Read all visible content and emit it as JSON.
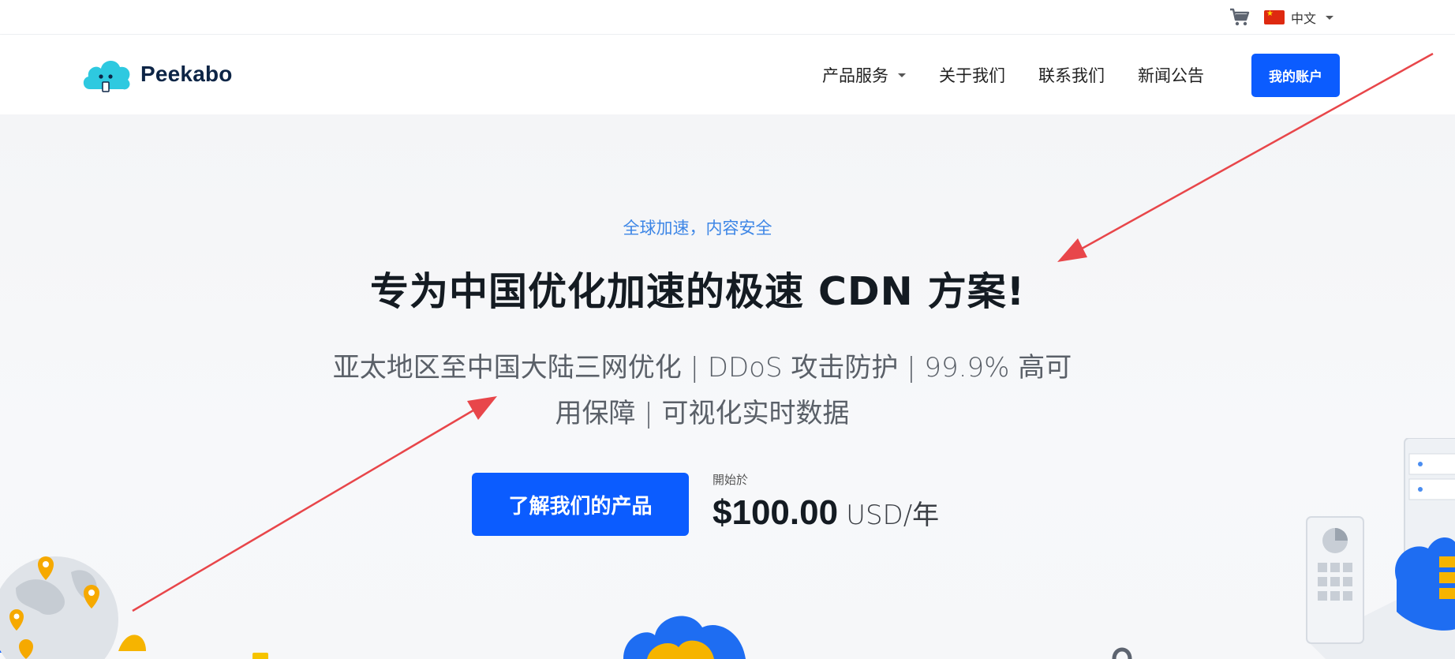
{
  "topbar": {
    "cart_icon": "shopping-cart-icon",
    "language": "中文",
    "flag_icon": "china-flag-icon"
  },
  "header": {
    "brand": "Peekabo",
    "nav": [
      {
        "label": "产品服务",
        "has_dropdown": true
      },
      {
        "label": "关于我们"
      },
      {
        "label": "联系我们"
      },
      {
        "label": "新闻公告"
      }
    ],
    "account_button": "我的账户"
  },
  "hero": {
    "eyebrow": "全球加速，内容安全",
    "headline": "专为中国优化加速的极速 CDN 方案!",
    "subline": "亚太地区至中国大陆三网优化 | DDoS 攻击防护 | 99.9% 高可用保障 | 可视化实时数据",
    "cta": "了解我们的产品",
    "price_label": "開始於",
    "price_amount": "$100.00",
    "price_unit": "USD/年"
  },
  "colors": {
    "primary": "#0b5cff",
    "eyebrow": "#3d86e6",
    "annotation_arrow": "#e8464a",
    "logo_cloud": "#2ec9e0"
  }
}
